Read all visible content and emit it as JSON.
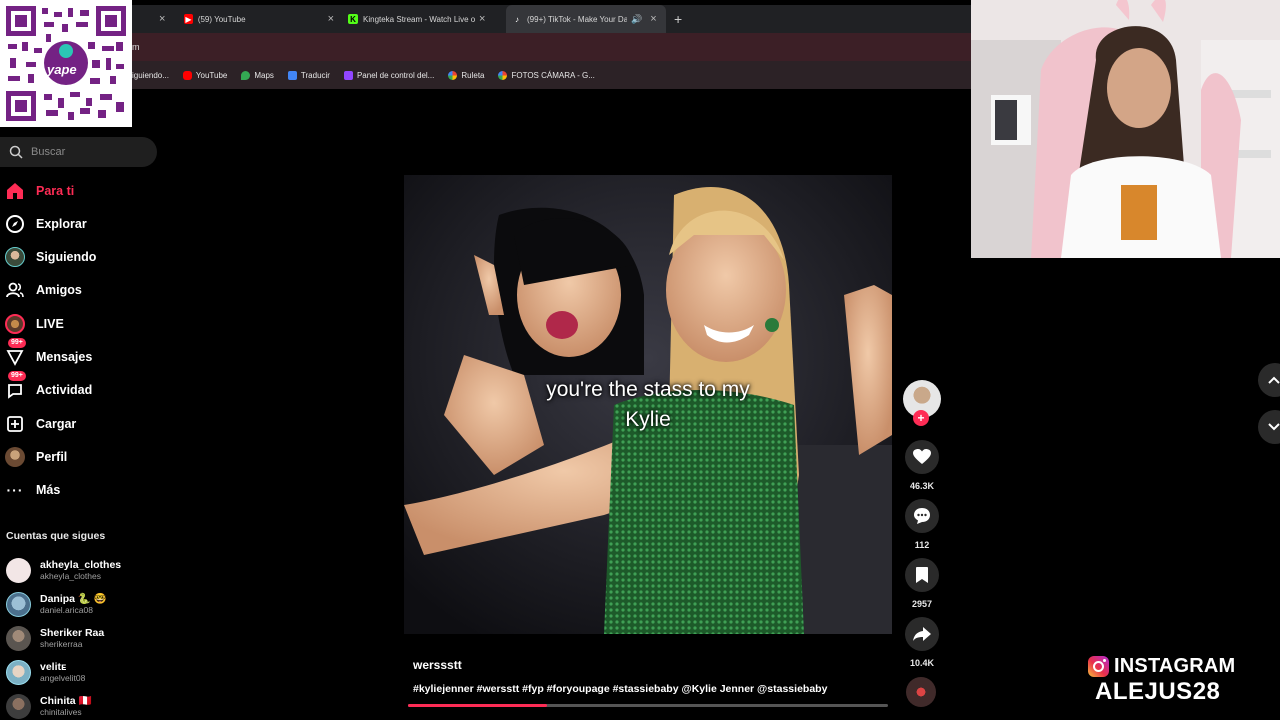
{
  "browser": {
    "tabs": [
      {
        "label": "(59) YouTube",
        "icon": "youtube-icon",
        "color": "#ff0000"
      },
      {
        "label": "Kingteka Stream - Watch Live o",
        "icon": "kick-icon",
        "color": "#53fc18"
      },
      {
        "label": "(99+) TikTok - Make Your Da",
        "icon": "tiktok-icon",
        "color": "#ffffff"
      }
    ],
    "new_tab": "+",
    "url_fragment": "m",
    "bookmarks": [
      {
        "label": "iguiendo...",
        "color": "#555555"
      },
      {
        "label": "YouTube",
        "color": "#ff0000"
      },
      {
        "label": "Maps",
        "color": "#34a853"
      },
      {
        "label": "Traducir",
        "color": "#4285f4"
      },
      {
        "label": "Panel de control del...",
        "color": "#9146ff"
      },
      {
        "label": "Ruleta",
        "color": "#fbbc05"
      },
      {
        "label": "FOTOS CÁMARA - G...",
        "color": "#ea4335"
      }
    ]
  },
  "qr": {
    "brand": "yape",
    "color": "#742284"
  },
  "sidebar": {
    "search_placeholder": "Buscar",
    "nav": [
      {
        "label": "Para ti",
        "icon": "home-icon",
        "active": true
      },
      {
        "label": "Explorar",
        "icon": "compass-icon"
      },
      {
        "label": "Siguiendo",
        "icon": "following-avatar-icon"
      },
      {
        "label": "Amigos",
        "icon": "friends-icon"
      },
      {
        "label": "LIVE",
        "icon": "live-icon"
      },
      {
        "label": "Mensajes",
        "icon": "messages-icon",
        "badge": "99+"
      },
      {
        "label": "Actividad",
        "icon": "activity-icon",
        "badge": "99+"
      },
      {
        "label": "Cargar",
        "icon": "upload-icon"
      },
      {
        "label": "Perfil",
        "icon": "profile-icon"
      },
      {
        "label": "Más",
        "icon": "more-icon"
      }
    ],
    "following_title": "Cuentas que sigues",
    "accounts": [
      {
        "name": "akheyla_clothes",
        "handle": "akheyla_clothes",
        "avatar_color": "#f2e6e6"
      },
      {
        "name": "Danipa 🐍 🤓",
        "handle": "daniel.arica08",
        "avatar_color": "#4b6f8c"
      },
      {
        "name": "Sheriker Raa",
        "handle": "sherikerraa",
        "avatar_color": "#5a5550"
      },
      {
        "name": "velitᴇ",
        "handle": "angelvelit08",
        "avatar_color": "#7bb0c4"
      },
      {
        "name": "Chinita 🇵🇪",
        "handle": "chinitalives",
        "avatar_color": "#3d3d3d"
      }
    ]
  },
  "video": {
    "caption_line1": "you're the stass to my",
    "caption_line2": "Kylie",
    "author": "werssstt",
    "description": "#kyliejenner #wersstt #fyp #foryoupage #stassiebaby @Kylie Jenner @stassiebaby",
    "progress_fraction": 0.29
  },
  "actions": {
    "likes": "46.3K",
    "comments": "112",
    "saves": "2957",
    "shares": "10.4K",
    "follow_plus": "+"
  },
  "overlay": {
    "instagram_label": "INSTAGRAM",
    "handle": "ALEJUS28"
  },
  "colors": {
    "tiktok_red": "#fe2c55",
    "background": "#000000",
    "chrome_dark": "#202124"
  }
}
